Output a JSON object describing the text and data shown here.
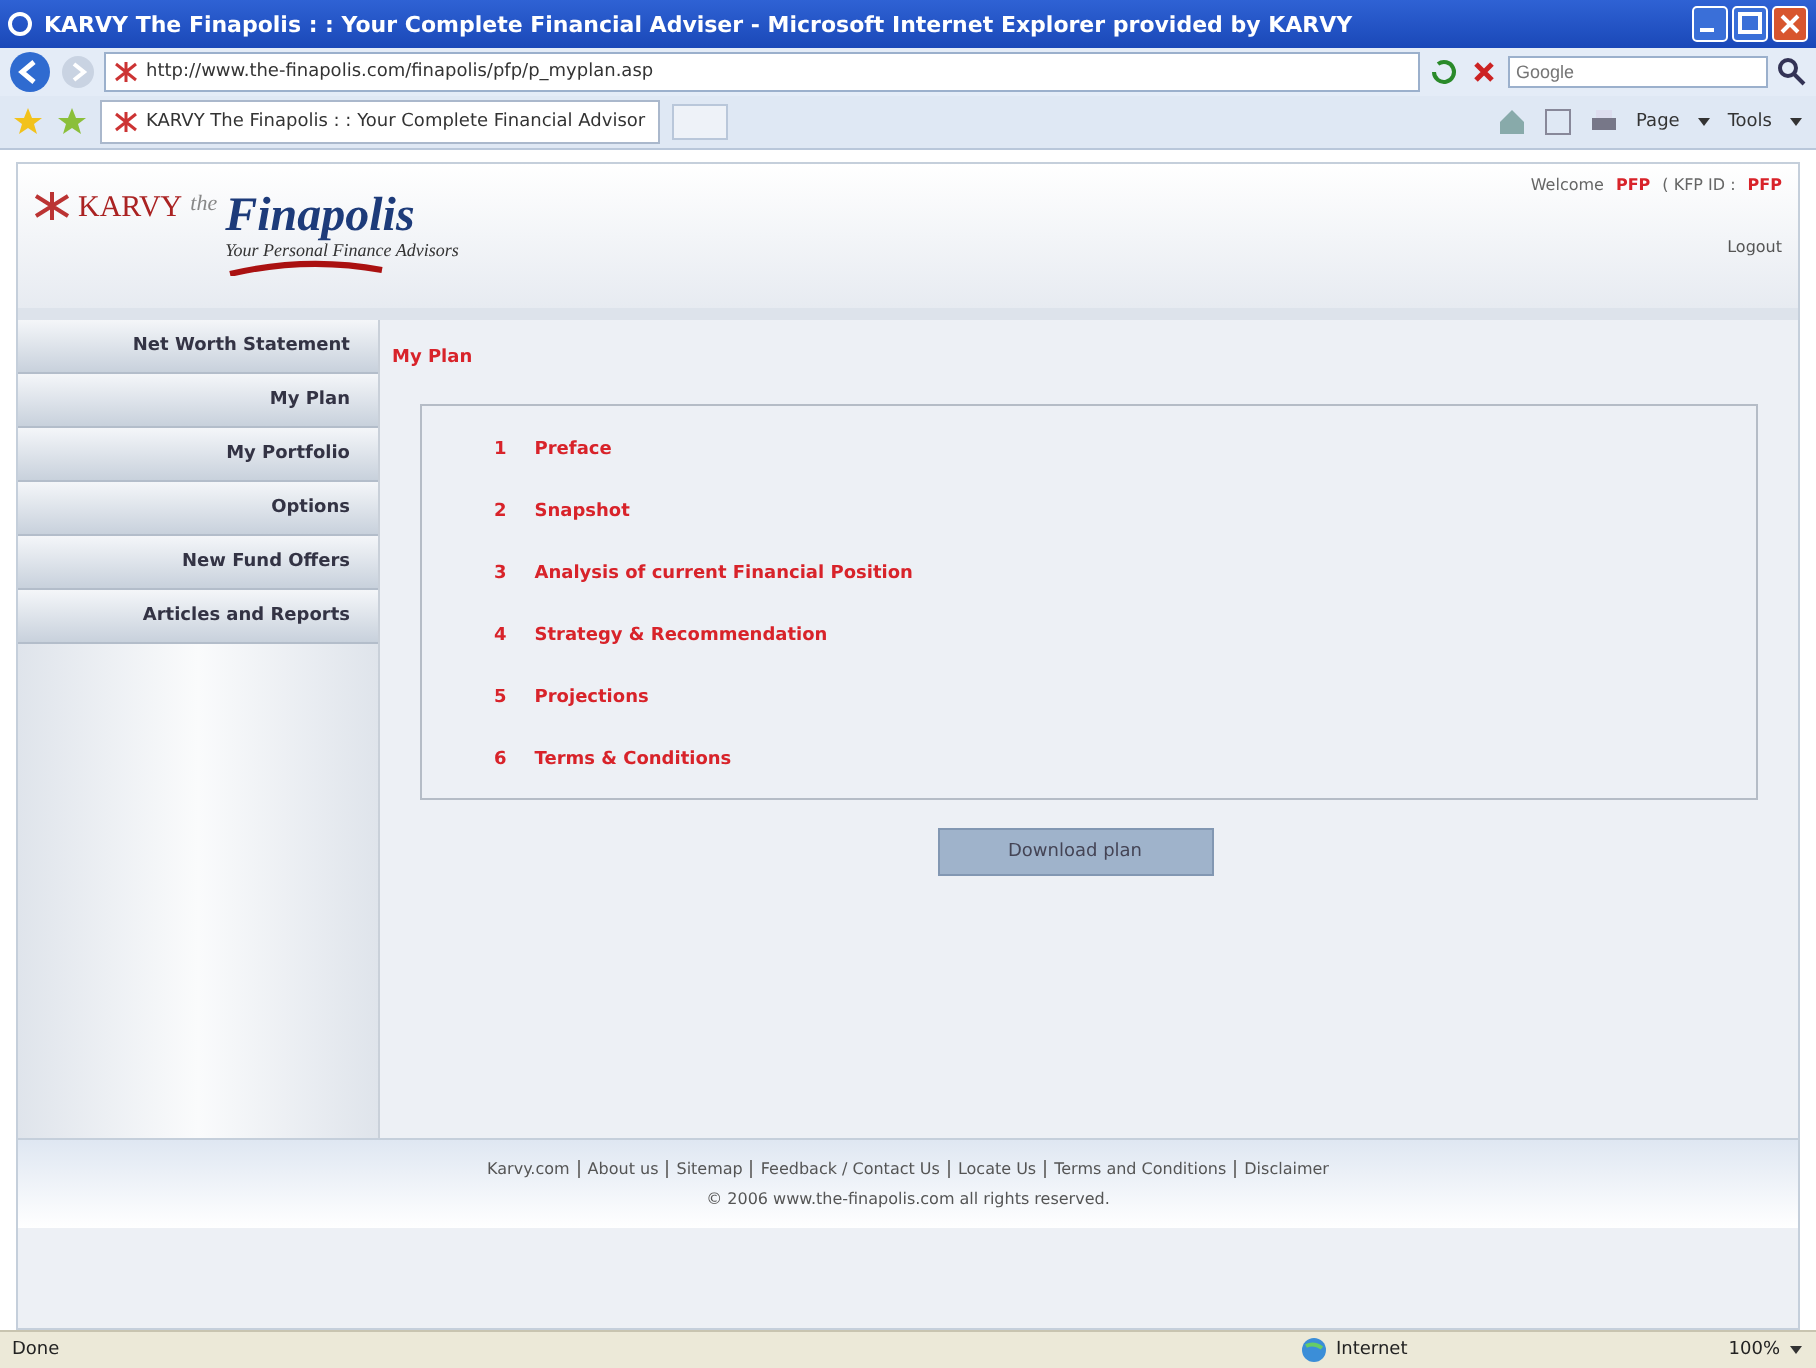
{
  "window": {
    "title": "KARVY The Finapolis : : Your Complete Financial Adviser - Microsoft Internet Explorer provided by KARVY"
  },
  "address_bar": {
    "url": "http://www.the-finapolis.com/finapolis/pfp/p_myplan.asp",
    "search_placeholder": "Google"
  },
  "browser_tab": {
    "label": "KARVY The Finapolis : : Your Complete Financial Advisor"
  },
  "toolbar": {
    "page": "Page",
    "tools": "Tools"
  },
  "header": {
    "brand": "KARVY",
    "the": "the",
    "logo": "Finapolis",
    "tagline": "Your Personal Finance Advisors",
    "welcome": "Welcome",
    "user": "PFP",
    "id_label": "( KFP ID :",
    "id_value": "PFP",
    "logout": "Logout"
  },
  "sidebar": {
    "items": [
      "Net Worth Statement",
      "My Plan",
      "My Portfolio",
      "Options",
      "New Fund Offers",
      "Articles and Reports"
    ]
  },
  "main": {
    "heading": "My Plan",
    "sections": [
      {
        "number": "1",
        "label": "Preface"
      },
      {
        "number": "2",
        "label": "Snapshot"
      },
      {
        "number": "3",
        "label": "Analysis of current Financial Position"
      },
      {
        "number": "4",
        "label": "Strategy & Recommendation"
      },
      {
        "number": "5",
        "label": "Projections"
      },
      {
        "number": "6",
        "label": "Terms & Conditions"
      }
    ],
    "button": "Download plan"
  },
  "footer": {
    "links": [
      "Karvy.com",
      "About us",
      "Sitemap",
      "Feedback / Contact Us",
      "Locate Us",
      "Terms and Conditions",
      "Disclaimer"
    ],
    "copyright": "© 2006 www.the-finapolis.com all rights reserved."
  },
  "status_bar": {
    "status": "Done",
    "zone": "Internet",
    "zoom": "100%"
  }
}
